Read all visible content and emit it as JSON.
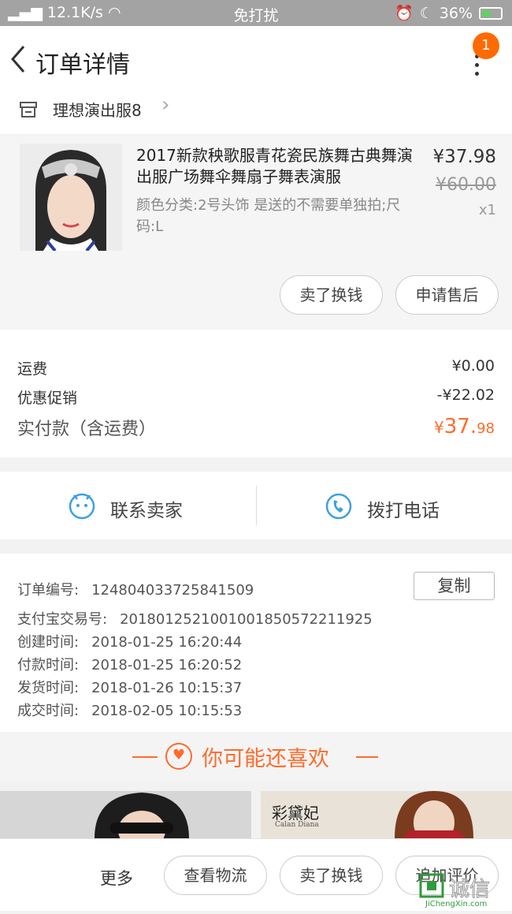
{
  "status_bar": {
    "signal": "12.1K/s",
    "mode": "免打扰",
    "battery": "36%"
  },
  "header": {
    "title": "订单详情",
    "badge": "1"
  },
  "shop": {
    "name": "理想演出服8"
  },
  "product": {
    "title": "2017新款秧歌服青花瓷民族舞古典舞演出服广场舞伞舞扇子舞表演服",
    "spec": "颜色分类:2号头饰 是送的不需要单独拍;尺码:L",
    "price": "¥37.98",
    "original_price": "¥60.00",
    "quantity": "x1",
    "buttons": {
      "resell": "卖了换钱",
      "after_sale": "申请售后"
    }
  },
  "fees": {
    "shipping_label": "运费",
    "shipping_value": "¥0.00",
    "discount_label": "优惠促销",
    "discount_value": "-¥22.02",
    "paid_label": "实付款（含运费）",
    "paid_symbol": "¥",
    "paid_int": "37.",
    "paid_dec": "98"
  },
  "contact": {
    "seller": "联系卖家",
    "phone": "拨打电话"
  },
  "order_info": {
    "copy": "复制",
    "rows": [
      {
        "k": "订单编号:",
        "v": "124804033725841509"
      },
      {
        "k": "支付宝交易号:",
        "v": "2018012521001001850572211925"
      },
      {
        "k": "创建时间:",
        "v": "2018-01-25 16:20:44"
      },
      {
        "k": "付款时间:",
        "v": "2018-01-25 16:20:52"
      },
      {
        "k": "发货时间:",
        "v": "2018-01-26 10:15:37"
      },
      {
        "k": "成交时间:",
        "v": "2018-02-05 10:15:53"
      }
    ]
  },
  "recommend": {
    "title": "你可能还喜欢",
    "brand": "彩黛妃",
    "brand_sub": "Calan Diana"
  },
  "bottom_bar": {
    "more": "更多",
    "logistics": "查看物流",
    "resell": "卖了换钱",
    "review": "追加评价"
  },
  "watermark": {
    "text": "诚信",
    "url": "JiChengXin.com"
  },
  "colors": {
    "accent": "#ff6b2c",
    "badge": "#ff6a00",
    "icon_blue": "#3aa0e6"
  }
}
